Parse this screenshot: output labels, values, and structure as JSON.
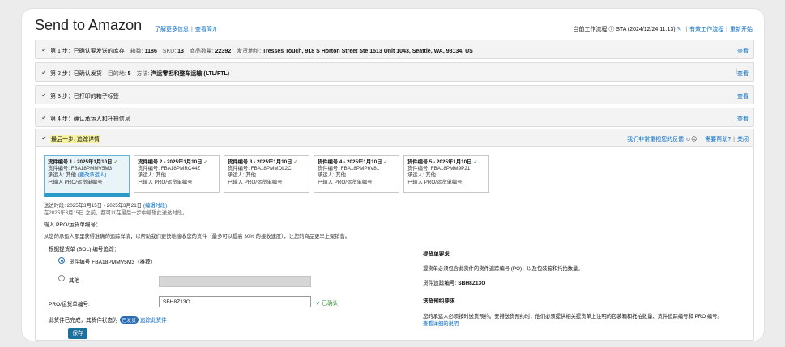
{
  "header": {
    "title": "Send to Amazon",
    "links": [
      "了解更多信息",
      "查看简介"
    ],
    "workflow_label": "当前工作流程",
    "workflow_value": "STA (2024/12/24 11:13)",
    "active_flows": "有效工作流程",
    "restart": "重新开始"
  },
  "steps": [
    {
      "title": "第 1 步：已确认要发送的库存",
      "meta": [
        {
          "k": "箱数:",
          "v": "1186"
        },
        {
          "k": "SKU:",
          "v": "13"
        },
        {
          "k": "商品数量:",
          "v": "22392"
        },
        {
          "k": "发货地址:",
          "v": "Tresses Touch, 918 S Horton Street Ste 1513 Unit 1043, Seattle, WA, 98134, US"
        }
      ],
      "view": "查看"
    },
    {
      "title": "第 2 步：已确认发货",
      "meta": [
        {
          "k": "目的地:",
          "v": "5"
        },
        {
          "k": "方法:",
          "v": "汽运零担和整车运输 (LTL/FTL)"
        }
      ],
      "view": "查看"
    },
    {
      "title": "第 3 步：已打印的箱子标签",
      "meta": [],
      "view": "查看"
    },
    {
      "title": "第 4 步：确认承运人和托拍信息",
      "meta": [],
      "view": "查看"
    }
  ],
  "final": {
    "title": "最后一步: 追踪详情",
    "feedback": "我们非常重视您的反馈",
    "help": "需要帮助?",
    "close": "关闭"
  },
  "shipments": [
    {
      "title": "货件编号 1 - 2025年1月10日",
      "id": "货件编号: FBA18PMMV5M3",
      "carrier": "承运人: 其他",
      "carrier_link": "(更改承运人)",
      "tracking": "已输入 PRO/运货单编号"
    },
    {
      "title": "货件编号 2 - 2025年1月10日",
      "id": "货件编号: FBA18PMRC44Z",
      "carrier": "承运人: 其他",
      "carrier_link": "",
      "tracking": "已输入 PRO/运货单编号"
    },
    {
      "title": "货件编号 3 - 2025年1月10日",
      "id": "货件编号: FBA18PMMDL2C",
      "carrier": "承运人: 其他",
      "carrier_link": "",
      "tracking": "已输入 PRO/运货单编号"
    },
    {
      "title": "货件编号 4 - 2025年1月10日",
      "id": "货件编号: FBA18PMP6V81",
      "carrier": "承运人: 其他",
      "carrier_link": "",
      "tracking": "已输入 PRO/运货单编号"
    },
    {
      "title": "货件编号 5 - 2025年1月10日",
      "id": "货件编号: FBA18PMM9P21",
      "carrier": "承运人: 其他",
      "carrier_link": "",
      "tracking": "已输入 PRO/运货单编号"
    }
  ],
  "delivery": {
    "window": "送达时段: 2025年3月15日 - 2025年3月21日",
    "window_link": "(编辑时段)",
    "note": "在2025年3月15日 之前，都可以在最后一步中编辑此送达时段。"
  },
  "form": {
    "heading": "输入 PRO/运货单编号：",
    "desc": "从您的承运人那里获得准确的追踪详情，以帮助我们更快地接收您的货件（最多可以提高 30% 的接收速度），让您的商品更早上架销售。",
    "bol_label": "根据提货单 (BOL) 编号追踪：",
    "radio1": "货件编号 FBA18PMMV5M3（推荐）",
    "radio2": "其他",
    "pro_label": "PRO/运货单编号:",
    "pro_value": "SBH8Z13O",
    "confirmed": "已确认",
    "status_text": "此货件已完成，其货件状态为",
    "status_badge": "已发货",
    "track_link": "追踪此货件",
    "save": "保存"
  },
  "right_panel": {
    "bol_title": "提货单要求",
    "bol_desc": "提货单必须包含此货件的货件追踪编号 (PO)，以及包装箱和托拍数量。",
    "tracking_label": "货件追踪编号:",
    "tracking_value": "SBH8Z13O",
    "appt_title": "送货预约要求",
    "appt_desc": "您的承运人必须按时送货预约。安排送货预约时，他们必须提供相关提货单上注明的包装箱和托拍数量、货件追踪编号和 PRO 编号。",
    "appt_link": "查看详细的说明"
  }
}
